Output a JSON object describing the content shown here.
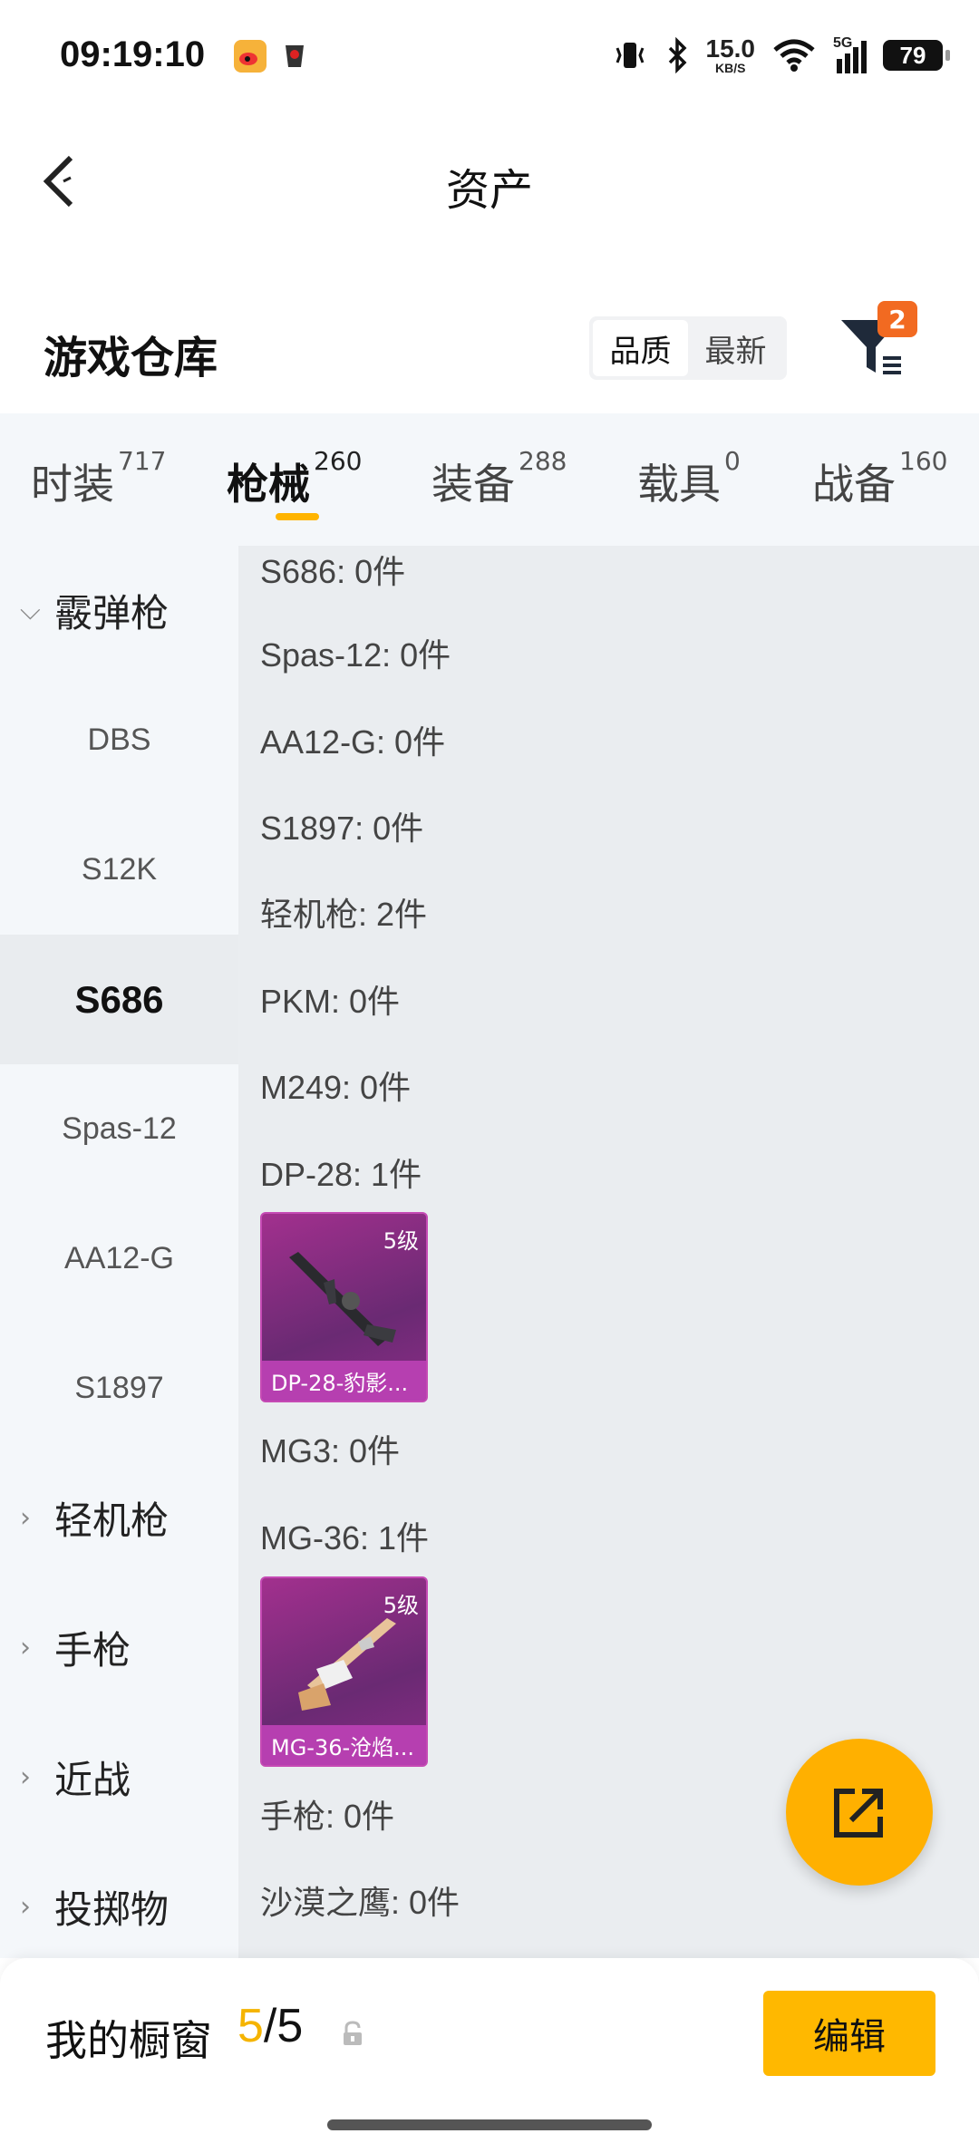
{
  "status_bar": {
    "time": "09:19:10",
    "net_speed": "15.0",
    "net_unit": "KB/S",
    "network": "5G",
    "battery": "79"
  },
  "header": {
    "title": "资产"
  },
  "warehouse": {
    "title": "游戏仓库",
    "sort_options": [
      "品质",
      "最新"
    ],
    "filter_badge": "2"
  },
  "tabs": [
    {
      "label": "时装",
      "count": "717"
    },
    {
      "label": "枪械",
      "count": "260"
    },
    {
      "label": "装备",
      "count": "288"
    },
    {
      "label": "载具",
      "count": "0"
    },
    {
      "label": "战备",
      "count": "160"
    }
  ],
  "sidebar": {
    "items": [
      {
        "label": "霰弹枪"
      },
      {
        "label": "DBS"
      },
      {
        "label": "S12K"
      },
      {
        "label": "S686"
      },
      {
        "label": "Spas-12"
      },
      {
        "label": "AA12-G"
      },
      {
        "label": "S1897"
      },
      {
        "label": "轻机枪"
      },
      {
        "label": "手枪"
      },
      {
        "label": "近战"
      },
      {
        "label": "投掷物"
      }
    ]
  },
  "content": {
    "rows": [
      "S686: 0件",
      "Spas-12: 0件",
      "AA12-G: 0件",
      "S1897: 0件",
      "轻机枪: 2件",
      "PKM: 0件",
      "M249: 0件",
      "DP-28: 1件",
      "MG3: 0件",
      "MG-36: 1件",
      "手枪: 0件",
      "沙漠之鹰: 0件"
    ],
    "cards": [
      {
        "level": "5级",
        "name": "DP-28-豹影..."
      },
      {
        "level": "5级",
        "name": "MG-36-沧焰..."
      }
    ]
  },
  "showcase": {
    "label": "我的橱窗",
    "current": "5",
    "separator": "/",
    "total": "5",
    "edit_label": "编辑"
  },
  "colors": {
    "accent": "#ffb400",
    "badge": "#f26a21",
    "card_purple": "#a2308e"
  }
}
